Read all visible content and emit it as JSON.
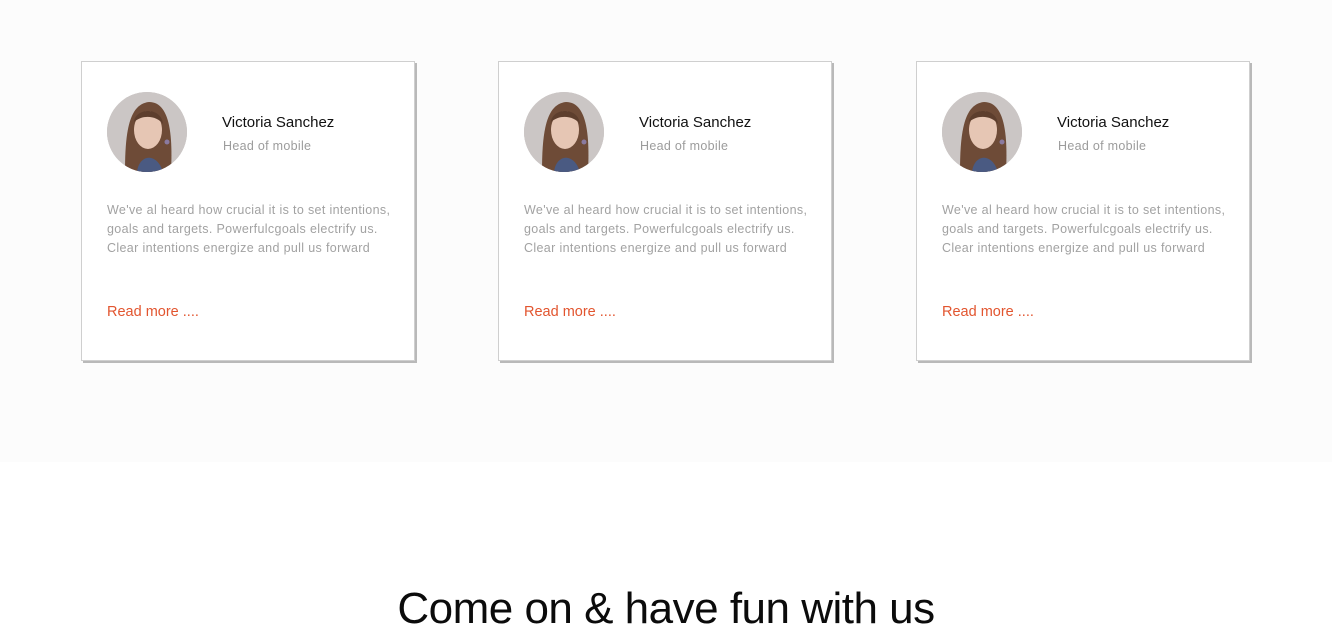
{
  "testimonials": [
    {
      "name": "Victoria Sanchez",
      "role": "Head of mobile",
      "quote": "We've al heard how crucial it is to set intentions, goals and targets. Powerfulcgoals electrify us. Clear intentions energize and pull us forward",
      "link_label": "Read more ...."
    },
    {
      "name": "Victoria Sanchez",
      "role": "Head of mobile",
      "quote": "We've al heard how crucial it is to set intentions, goals and targets. Powerfulcgoals electrify us. Clear intentions energize and pull us forward",
      "link_label": "Read more ...."
    },
    {
      "name": "Victoria Sanchez",
      "role": "Head of mobile",
      "quote": "We've al heard how crucial it is to set intentions, goals and targets. Powerfulcgoals electrify us. Clear intentions energize and pull us forward",
      "link_label": "Read more ...."
    }
  ],
  "section_heading": "Come on & have fun with us",
  "colors": {
    "accent": "#e2552f",
    "section_background": "#fcfcfc",
    "muted_text": "#a2a2a2"
  }
}
